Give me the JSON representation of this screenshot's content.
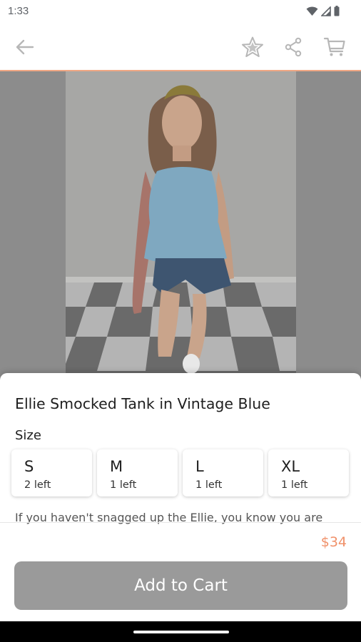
{
  "status_bar": {
    "time": "1:33",
    "icons": [
      "wifi-icon",
      "signal-icon",
      "battery-icon"
    ]
  },
  "toolbar": {
    "icons": [
      "back-arrow-icon",
      "star-icon",
      "share-icon",
      "cart-icon"
    ]
  },
  "product": {
    "title": "Ellie Smocked Tank in Vintage Blue",
    "size_label": "Size",
    "sizes": [
      {
        "name": "S",
        "stock": "2 left"
      },
      {
        "name": "M",
        "stock": "1 left"
      },
      {
        "name": "L",
        "stock": "1 left"
      },
      {
        "name": "XL",
        "stock": "1 left"
      }
    ],
    "description": "If you haven't snagged up the Ellie, you know you are",
    "price": "$34",
    "add_to_cart_label": "Add to Cart"
  },
  "colors": {
    "accent": "#f0916a",
    "divider": "#f0a784",
    "button": "#9a9a9a"
  }
}
